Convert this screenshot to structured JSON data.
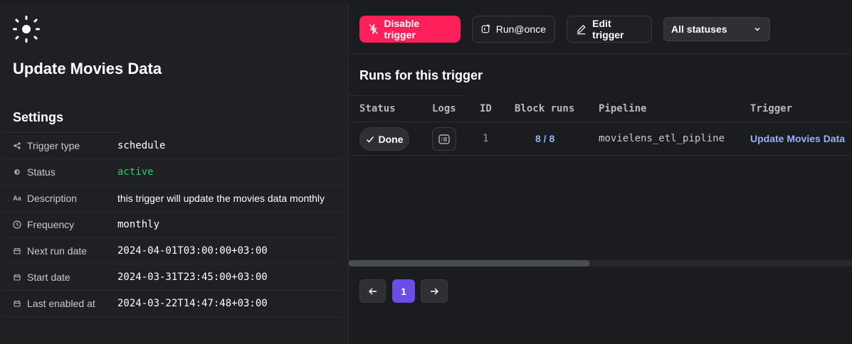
{
  "trigger": {
    "title": "Update Movies Data",
    "settings_title": "Settings",
    "settings": [
      {
        "icon": "trigger-type-icon",
        "label": "Trigger type",
        "value": "schedule"
      },
      {
        "icon": "status-icon",
        "label": "Status",
        "value": "active"
      },
      {
        "icon": "description-icon",
        "label": "Description",
        "value": "this trigger will update the movies data monthly"
      },
      {
        "icon": "clock-icon",
        "label": "Frequency",
        "value": "monthly"
      },
      {
        "icon": "calendar-icon",
        "label": "Next run date",
        "value": "2024-04-01T03:00:00+03:00"
      },
      {
        "icon": "calendar-icon",
        "label": "Start date",
        "value": "2024-03-31T23:45:00+03:00"
      },
      {
        "icon": "calendar-icon",
        "label": "Last enabled at",
        "value": "2024-03-22T14:47:48+03:00"
      }
    ]
  },
  "toolbar": {
    "disable_label": "Disable trigger",
    "run_once_label": "Run@once",
    "edit_label": "Edit trigger",
    "status_filter": "All statuses"
  },
  "runs": {
    "title": "Runs for this trigger",
    "columns": [
      "Status",
      "Logs",
      "ID",
      "Block runs",
      "Pipeline",
      "Trigger"
    ],
    "rows": [
      {
        "status": "Done",
        "id": "1",
        "block_runs": "8 / 8",
        "pipeline": "movielens_etl_pipline",
        "trigger": "Update Movies Data"
      }
    ]
  },
  "pagination": {
    "current_page": "1"
  },
  "colors": {
    "accent_pink": "#ff1f5a",
    "active_green": "#2fcb71",
    "link_blue": "#8fb3ff",
    "page_purple": "#6b4de6"
  }
}
